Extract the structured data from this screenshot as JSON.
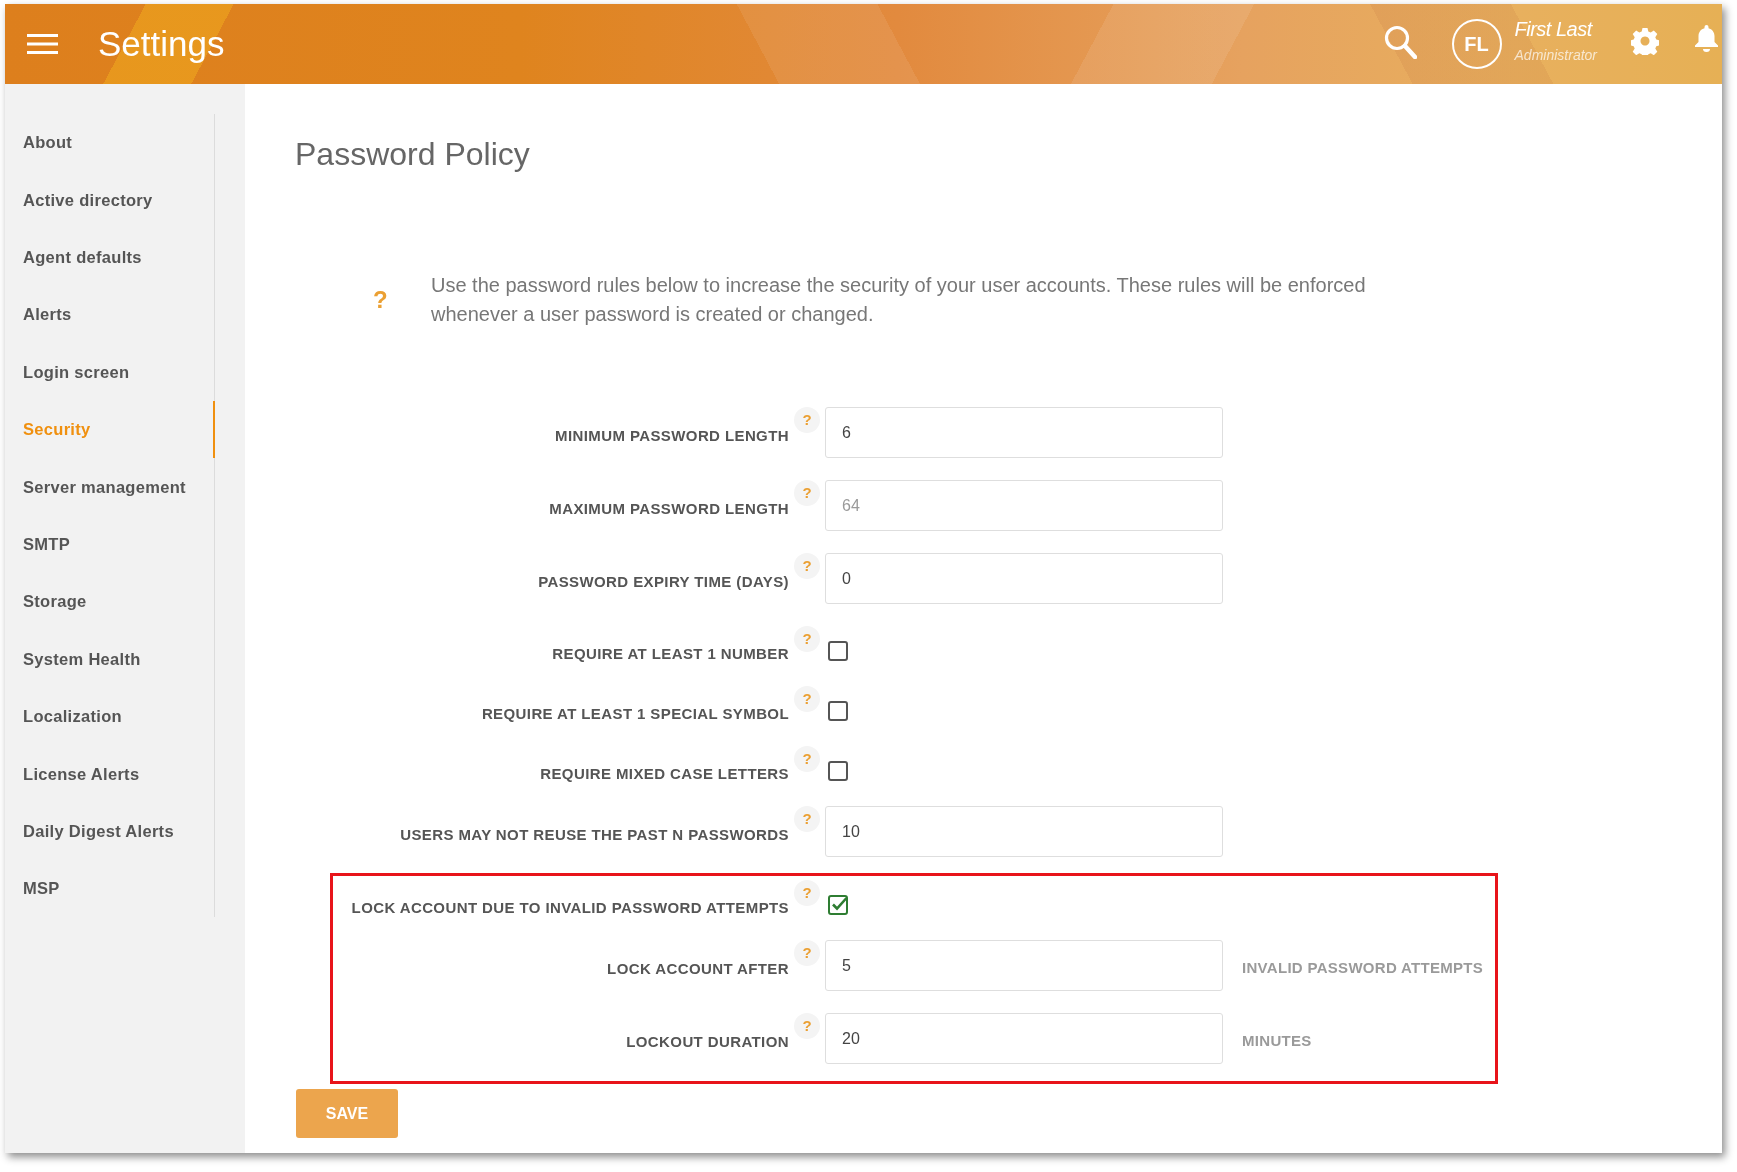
{
  "header": {
    "title": "Settings",
    "user": {
      "initials": "FL",
      "name": "First Last",
      "role": "Administrator"
    }
  },
  "sidebar": {
    "items": [
      {
        "label": "About",
        "selected": false
      },
      {
        "label": "Active directory",
        "selected": false
      },
      {
        "label": "Agent defaults",
        "selected": false
      },
      {
        "label": "Alerts",
        "selected": false
      },
      {
        "label": "Login screen",
        "selected": false
      },
      {
        "label": "Security",
        "selected": true
      },
      {
        "label": "Server management",
        "selected": false
      },
      {
        "label": "SMTP",
        "selected": false
      },
      {
        "label": "Storage",
        "selected": false
      },
      {
        "label": "System Health",
        "selected": false
      },
      {
        "label": "Localization",
        "selected": false
      },
      {
        "label": "License Alerts",
        "selected": false
      },
      {
        "label": "Daily Digest Alerts",
        "selected": false
      },
      {
        "label": "MSP",
        "selected": false
      }
    ]
  },
  "page": {
    "title": "Password Policy",
    "info_mark": "?",
    "info": "Use the password rules below to increase the security of your user accounts. These rules will be enforced whenever a user password is created or changed."
  },
  "form": {
    "fields": [
      {
        "kind": "text",
        "label": "MINIMUM PASSWORD LENGTH",
        "help": "?",
        "value": "6"
      },
      {
        "kind": "text",
        "label": "MAXIMUM PASSWORD LENGTH",
        "help": "?",
        "placeholder": "64"
      },
      {
        "kind": "text",
        "label": "PASSWORD EXPIRY TIME (DAYS)",
        "help": "?",
        "value": "0"
      },
      {
        "kind": "checkbox",
        "label": "REQUIRE AT LEAST 1 NUMBER",
        "help": "?",
        "checked": false
      },
      {
        "kind": "checkbox",
        "label": "REQUIRE AT LEAST 1 SPECIAL SYMBOL",
        "help": "?",
        "checked": false
      },
      {
        "kind": "checkbox",
        "label": "REQUIRE MIXED CASE LETTERS",
        "help": "?",
        "checked": false
      },
      {
        "kind": "text",
        "label": "USERS MAY NOT REUSE THE PAST N PASSWORDS",
        "help": "?",
        "value": "10"
      }
    ],
    "highlighted_fields": [
      {
        "kind": "checkbox",
        "label": "LOCK ACCOUNT DUE TO INVALID PASSWORD ATTEMPTS",
        "help": "?",
        "checked": true
      },
      {
        "kind": "text",
        "label": "LOCK ACCOUNT AFTER",
        "help": "?",
        "value": "5",
        "suffix": "INVALID PASSWORD ATTEMPTS"
      },
      {
        "kind": "text",
        "label": "LOCKOUT DURATION",
        "help": "?",
        "value": "20",
        "suffix": "MINUTES"
      }
    ]
  },
  "save_button": "SAVE"
}
